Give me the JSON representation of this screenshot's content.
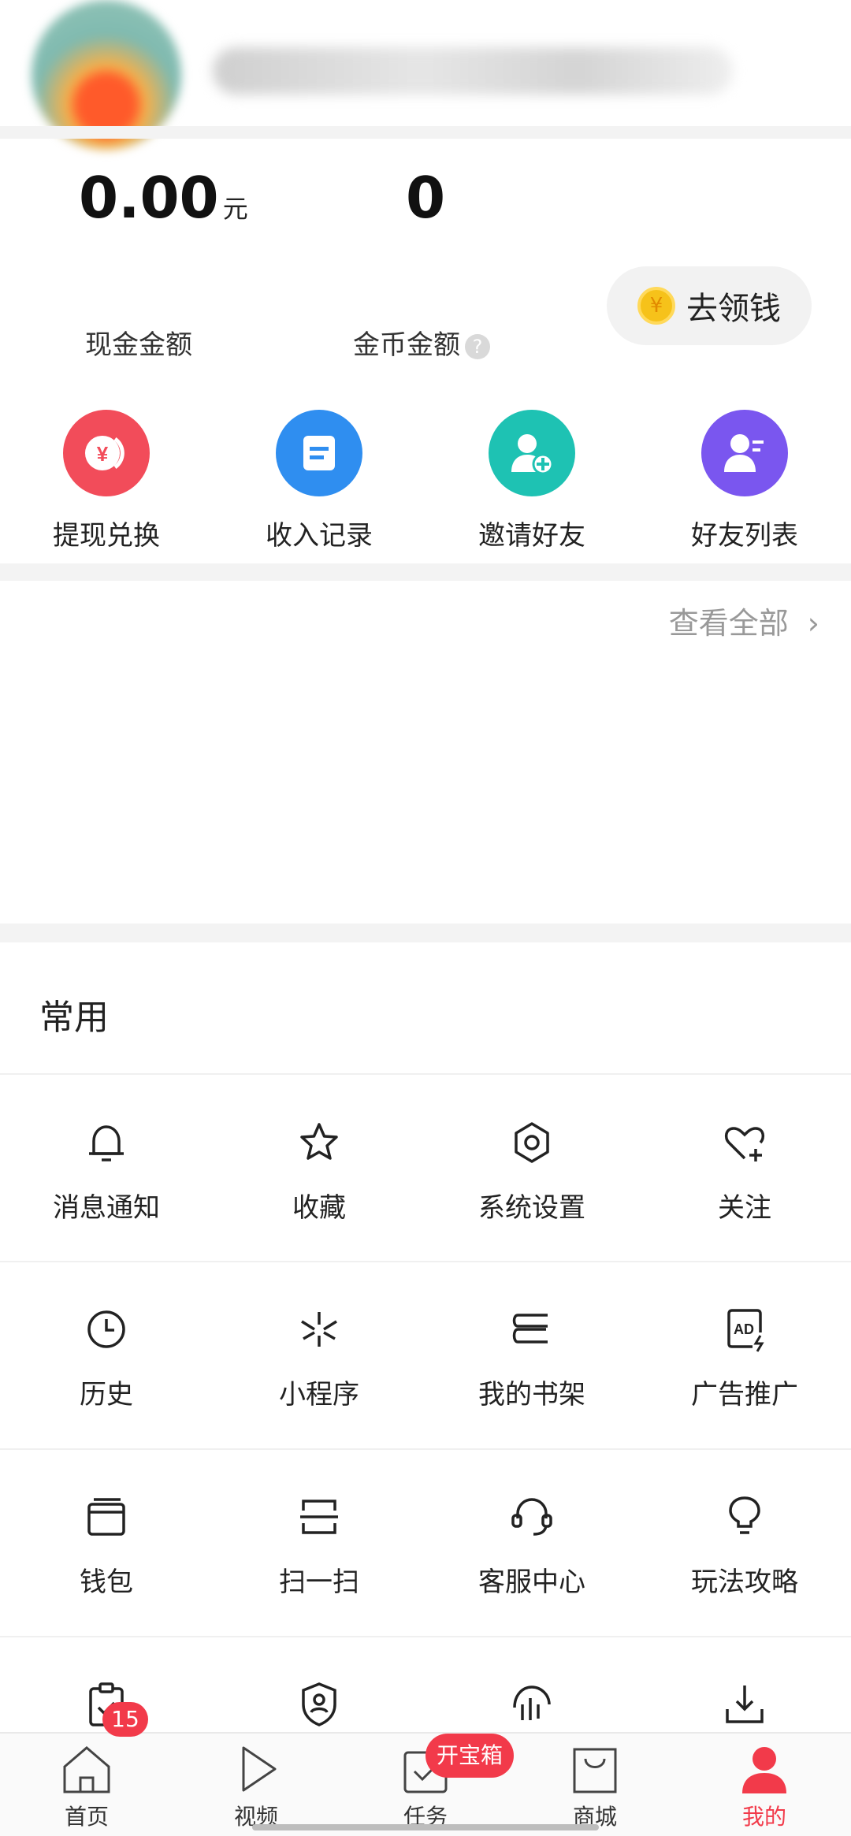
{
  "wallet": {
    "cash_value": "0.00",
    "cash_unit": "元",
    "cash_label": "现金金额",
    "coin_value": "0",
    "coin_label": "金币金额",
    "help_mark": "?",
    "get_money_label": "去领钱",
    "coin_symbol": "¥"
  },
  "quick_actions": [
    {
      "label": "提现兑换",
      "icon": "withdraw-icon",
      "color": "#f24c5a"
    },
    {
      "label": "收入记录",
      "icon": "record-icon",
      "color": "#2f8ef0"
    },
    {
      "label": "邀请好友",
      "icon": "invite-icon",
      "color": "#1ec2b3"
    },
    {
      "label": "好友列表",
      "icon": "friends-list-icon",
      "color": "#7a56ef"
    }
  ],
  "view_all": "查看全部",
  "section_title": "常用",
  "common_items": [
    {
      "label": "消息通知",
      "icon": "bell-icon"
    },
    {
      "label": "收藏",
      "icon": "star-icon"
    },
    {
      "label": "系统设置",
      "icon": "gear-icon"
    },
    {
      "label": "关注",
      "icon": "heart-plus-icon"
    },
    {
      "label": "历史",
      "icon": "clock-icon"
    },
    {
      "label": "小程序",
      "icon": "mini-program-icon"
    },
    {
      "label": "我的书架",
      "icon": "bookshelf-icon"
    },
    {
      "label": "广告推广",
      "icon": "ad-icon"
    },
    {
      "label": "钱包",
      "icon": "wallet-icon"
    },
    {
      "label": "扫一扫",
      "icon": "scan-icon"
    },
    {
      "label": "客服中心",
      "icon": "headset-icon"
    },
    {
      "label": "玩法攻略",
      "icon": "bulb-icon"
    },
    {
      "label": "",
      "icon": "clipboard-check-icon"
    },
    {
      "label": "",
      "icon": "shield-user-icon"
    },
    {
      "label": "",
      "icon": "chart-icon"
    },
    {
      "label": "",
      "icon": "download-icon"
    }
  ],
  "bottom_nav": [
    {
      "label": "首页",
      "icon": "home-icon"
    },
    {
      "label": "视频",
      "icon": "play-icon"
    },
    {
      "label": "任务",
      "icon": "task-icon"
    },
    {
      "label": "商城",
      "icon": "shopping-bag-icon"
    },
    {
      "label": "我的",
      "icon": "person-icon"
    }
  ],
  "badges": {
    "home_count": "15",
    "task_chest": "开宝箱"
  },
  "colors": {
    "accent": "#f23a4a",
    "active_nav": "#f23a4a",
    "section_gap": "#f3f3f3"
  }
}
